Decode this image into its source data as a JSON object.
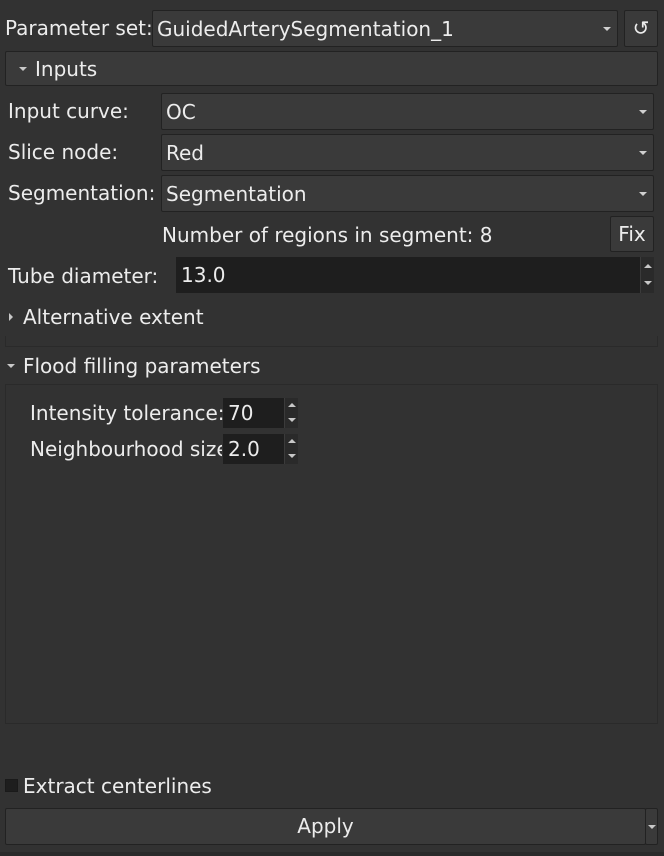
{
  "parameter_set": {
    "label": "Parameter set:",
    "value": "GuidedArterySegmentation_1",
    "reset_icon": "↺"
  },
  "inputs_section": {
    "title": "Inputs",
    "input_curve": {
      "label": "Input curve:",
      "value": "OC"
    },
    "slice_node": {
      "label": "Slice node:",
      "value": "Red"
    },
    "segmentation": {
      "label": "Segmentation:",
      "value": "Segmentation"
    },
    "regions_info": "Number of regions in segment: 8",
    "fix_button": "Fix",
    "tube_diameter": {
      "label": "Tube diameter:",
      "value": "13.0"
    }
  },
  "alternative_extent": {
    "title": "Alternative extent"
  },
  "flood_filling": {
    "title": "Flood filling parameters",
    "intensity_tolerance": {
      "label": "Intensity tolerance:",
      "value": "70"
    },
    "neighbourhood_size": {
      "label": "Neighbourhood size:",
      "value": "2.0"
    }
  },
  "extract_centerlines": {
    "label": "Extract centerlines",
    "checked": false
  },
  "apply_button": {
    "label": "Apply"
  }
}
